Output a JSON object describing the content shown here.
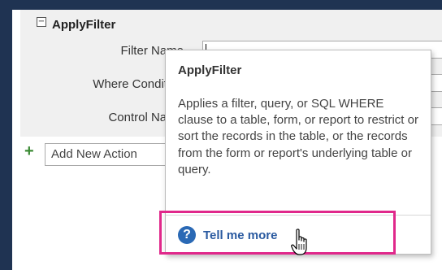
{
  "macro_block": {
    "collapse_glyph": "−",
    "title": "ApplyFilter",
    "arguments": [
      {
        "label": "Filter Name",
        "value": ""
      },
      {
        "label": "Where Condition",
        "value": ""
      },
      {
        "label": "Control Name",
        "value": ""
      }
    ]
  },
  "add_action": {
    "icon": "plus-icon",
    "placeholder": "Add New Action"
  },
  "tooltip": {
    "title": "ApplyFilter",
    "description": "Applies a filter, query, or SQL WHERE clause to a table, form, or report to restrict or sort the records in the table, or the records from the form or report's underlying table or query.",
    "help_icon": "question-circle-icon",
    "help_label": "Tell me more"
  },
  "colors": {
    "background": "#1f3352",
    "highlight": "#e0288b",
    "link": "#2a5aa0",
    "add_icon": "#3b8a34"
  }
}
